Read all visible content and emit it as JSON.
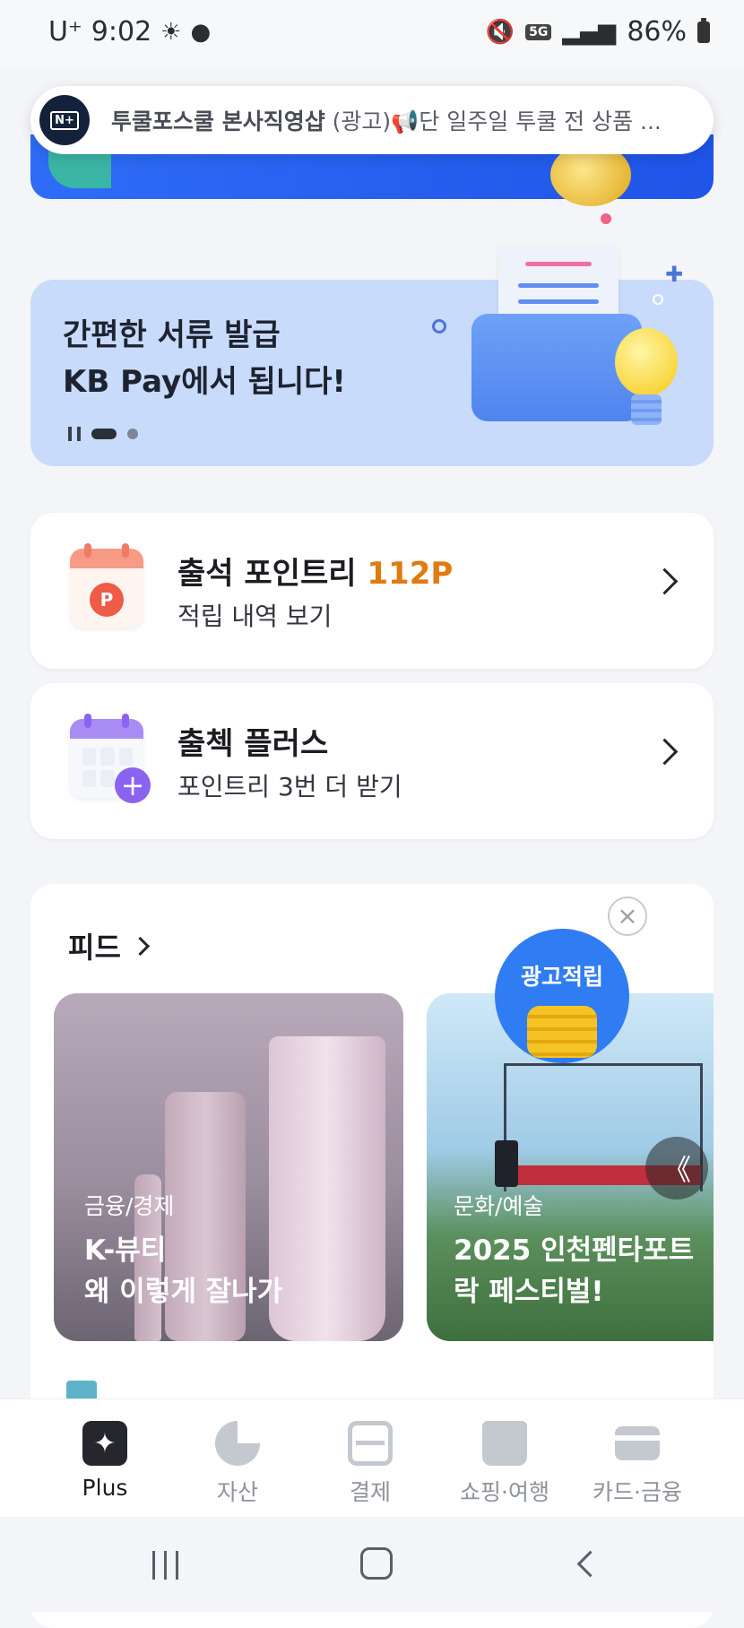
{
  "status_bar": {
    "carrier": "U⁺",
    "time": "9:02",
    "network": "5G",
    "battery": "86%"
  },
  "ad_banner": {
    "logo": "N+",
    "brand": "투쿨포스쿨 본사직영샵",
    "text": "(광고)📢단 일주일 투쿨 전 상품 ..."
  },
  "promo": {
    "line1": "간편한 서류 발급",
    "line2": "KB Pay에서 됩니다!"
  },
  "attendance": {
    "title": "출석 포인트리",
    "points": "112P",
    "subtitle": "적립 내역 보기"
  },
  "checkin_plus": {
    "title": "출첵 플러스",
    "subtitle": "포인트리 3번 더 받기"
  },
  "feed": {
    "title": "피드",
    "close": "×",
    "cards": [
      {
        "tag": "금융/경제",
        "title_line1": "K-뷰티",
        "title_line2": "왜 이렇게 잘나가"
      },
      {
        "tag": "문화/예술",
        "title_line1": "2025 인천펜타포트",
        "title_line2": "락 페스티벌!",
        "badge": "광고적립"
      }
    ],
    "arrow": "《"
  },
  "bottom_nav": [
    {
      "label": "Plus",
      "icon": "plus-sparkle-icon"
    },
    {
      "label": "자산",
      "icon": "pie-chart-icon"
    },
    {
      "label": "결제",
      "icon": "scan-icon"
    },
    {
      "label": "쇼핑·여행",
      "icon": "shopping-bag-icon"
    },
    {
      "label": "카드·금융",
      "icon": "card-icon"
    }
  ]
}
